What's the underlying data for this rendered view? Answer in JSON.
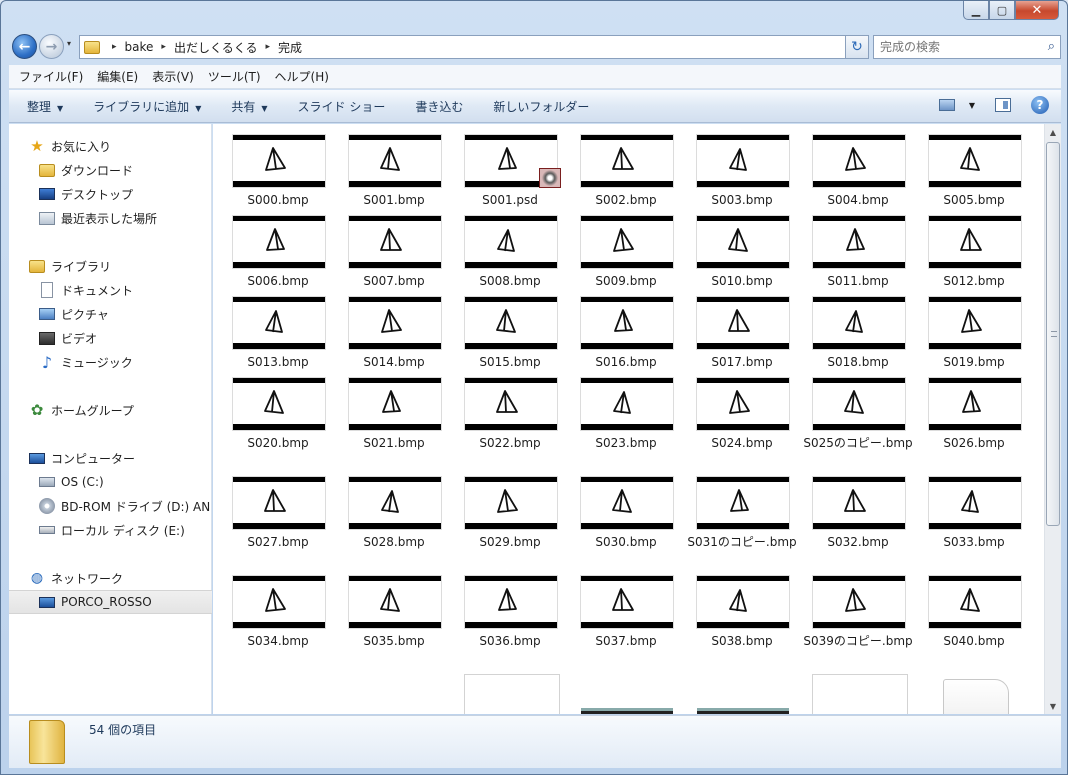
{
  "window": {
    "caption_buttons": {
      "minimize": "▁",
      "maximize": "▢",
      "close": "✕"
    }
  },
  "nav": {
    "back_glyph": "←",
    "forward_glyph": "→",
    "history_glyph": "▾",
    "breadcrumbs": [
      "bake",
      "出だしくるくる",
      "完成"
    ],
    "crumb_separator": "▸",
    "address_dropdown": "▾",
    "refresh_glyph": "↻",
    "search_placeholder": "完成の検索",
    "search_glyph": "⌕"
  },
  "menu": {
    "items": [
      "ファイル(F)",
      "編集(E)",
      "表示(V)",
      "ツール(T)",
      "ヘルプ(H)"
    ]
  },
  "toolbar": {
    "organize": "整理",
    "add_to_library": "ライブラリに追加",
    "share": "共有",
    "slideshow": "スライド ショー",
    "burn": "書き込む",
    "new_folder": "新しいフォルダー",
    "dropdown_arrow": "▼",
    "help_glyph": "?"
  },
  "sidebar": {
    "favorites": {
      "label": "お気に入り",
      "items": [
        "ダウンロード",
        "デスクトップ",
        "最近表示した場所"
      ]
    },
    "libraries": {
      "label": "ライブラリ",
      "items": [
        "ドキュメント",
        "ピクチャ",
        "ビデオ",
        "ミュージック"
      ]
    },
    "homegroup": {
      "label": "ホームグループ"
    },
    "computer": {
      "label": "コンピューター",
      "items": [
        "OS (C:)",
        "BD-ROM ドライブ (D:) AN",
        "ローカル ディスク (E:)"
      ]
    },
    "network": {
      "label": "ネットワーク",
      "items": [
        "PORCO_ROSSO"
      ]
    }
  },
  "files": [
    "S000.bmp",
    "S001.bmp",
    "S001.psd",
    "S002.bmp",
    "S003.bmp",
    "S004.bmp",
    "S005.bmp",
    "S006.bmp",
    "S007.bmp",
    "S008.bmp",
    "S009.bmp",
    "S010.bmp",
    "S011.bmp",
    "S012.bmp",
    "S013.bmp",
    "S014.bmp",
    "S015.bmp",
    "S016.bmp",
    "S017.bmp",
    "S018.bmp",
    "S019.bmp",
    "S020.bmp",
    "S021.bmp",
    "S022.bmp",
    "S023.bmp",
    "S024.bmp",
    "S025のコピー.bmp",
    "S026.bmp",
    "S027.bmp",
    "S028.bmp",
    "S029.bmp",
    "S030.bmp",
    "S031のコピー.bmp",
    "S032.bmp",
    "S033.bmp",
    "S034.bmp",
    "S035.bmp",
    "S036.bmp",
    "S037.bmp",
    "S038.bmp",
    "S039のコピー.bmp",
    "S040.bmp"
  ],
  "details": {
    "item_count": "54 個の項目"
  },
  "scrollbar": {
    "up_glyph": "▲",
    "down_glyph": "▼"
  }
}
